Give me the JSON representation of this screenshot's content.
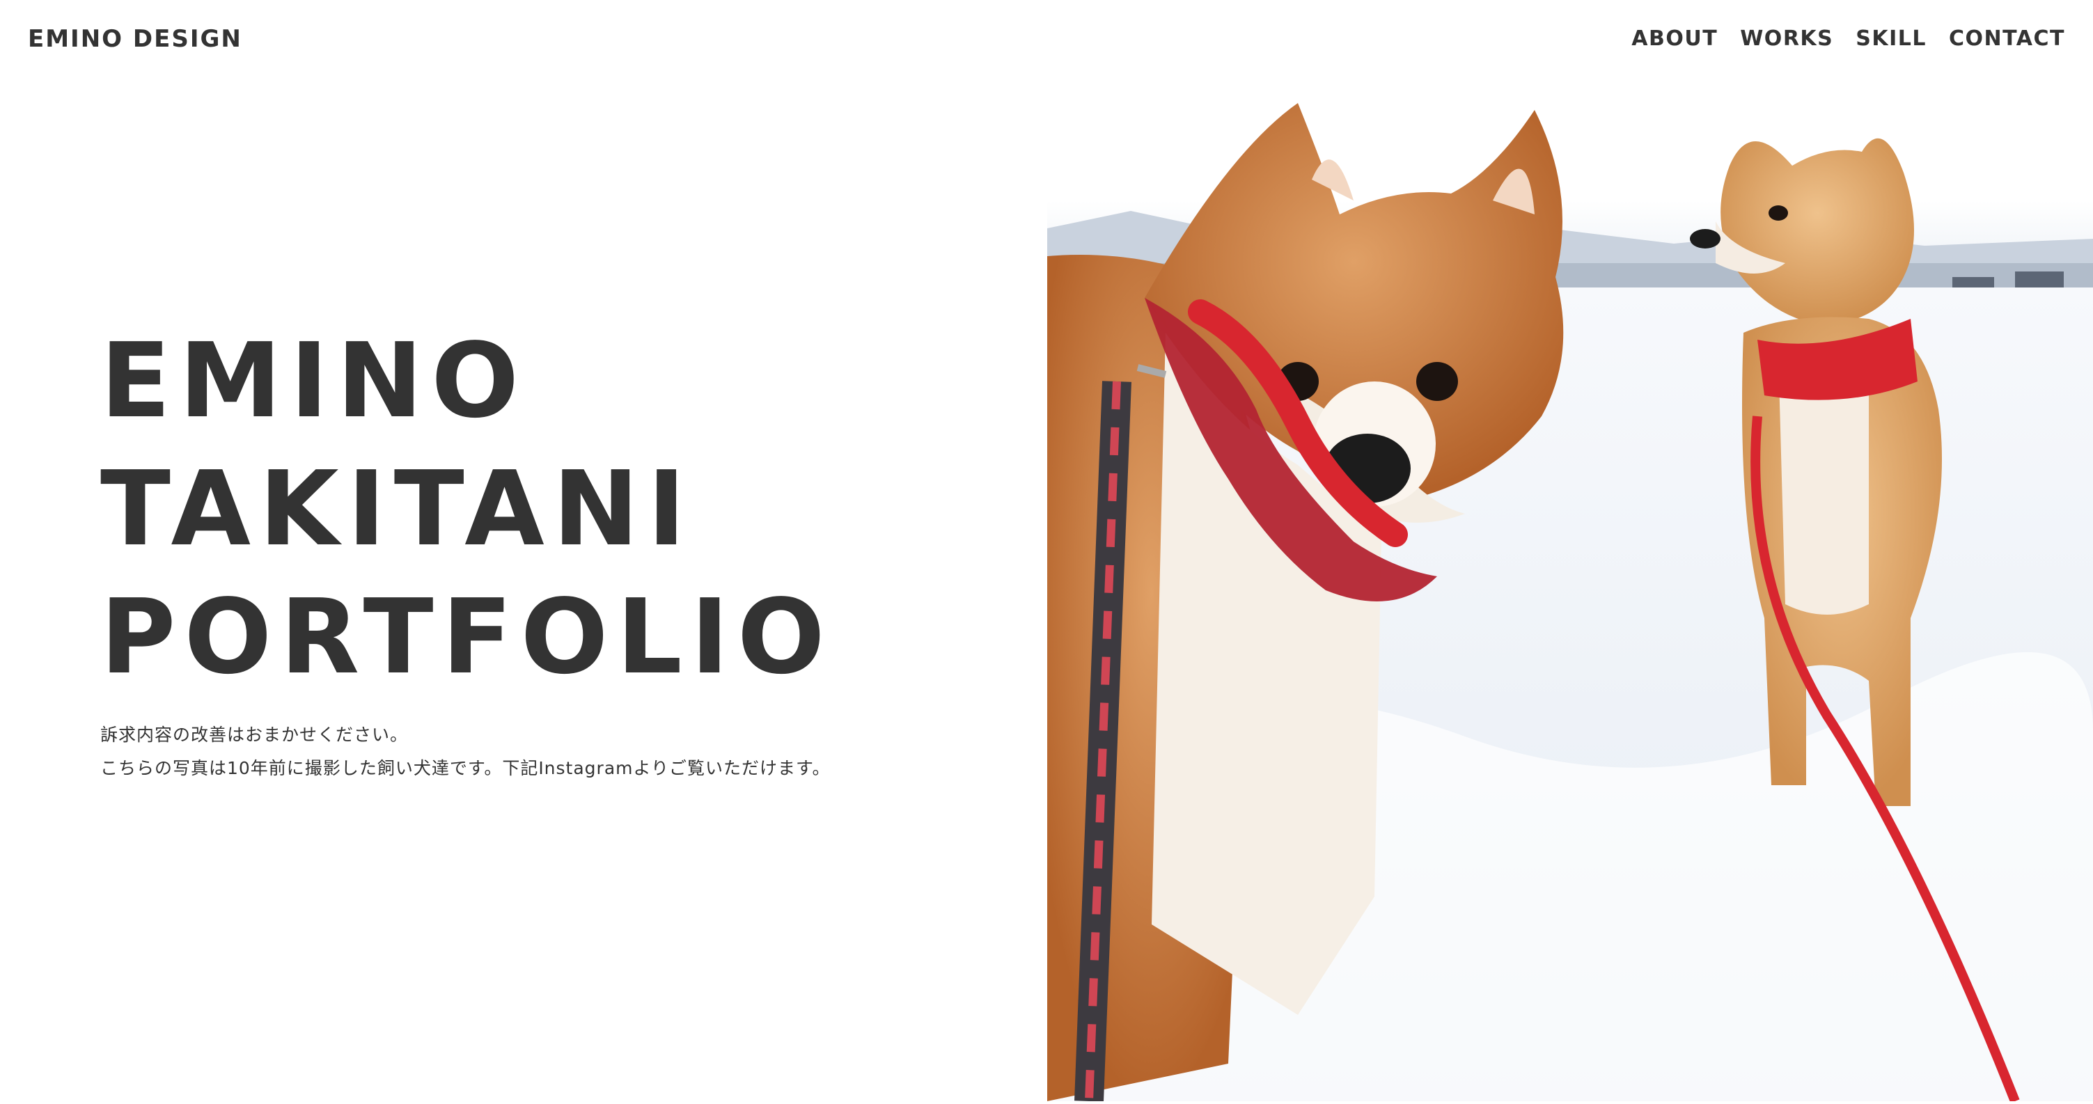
{
  "site": {
    "logo": "EMINO DESIGN"
  },
  "nav": {
    "items": [
      {
        "label": "ABOUT"
      },
      {
        "label": "WORKS"
      },
      {
        "label": "SKILL"
      },
      {
        "label": "CONTACT"
      }
    ]
  },
  "hero": {
    "title_lines": [
      "EMINO",
      "TAKITANI",
      "PORTFOLIO"
    ],
    "description": [
      "訴求内容の改善はおまかせください。",
      "こちらの写真は10年前に撮影した飼い犬達です。下記Instagramよりご覧いただけます。"
    ]
  },
  "colors": {
    "text": "#333333",
    "background": "#ffffff",
    "snow": "#f3f6fb",
    "fur": "#c87a3c",
    "collar": "#d8262f"
  }
}
